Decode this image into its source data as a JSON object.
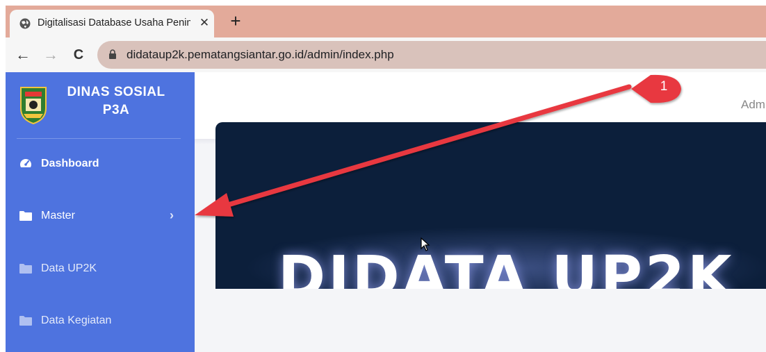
{
  "browser": {
    "tab": {
      "title": "Digitalisasi Database Usaha Penin",
      "close_glyph": "✕"
    },
    "new_tab_glyph": "+",
    "nav": {
      "back_glyph": "←",
      "forward_glyph": "→",
      "reload_glyph": "C"
    },
    "url": "didataup2k.pematangsiantar.go.id/admin/index.php"
  },
  "sidebar": {
    "brand_line1": "DINAS SOSIAL",
    "brand_line2": "P3A",
    "items": [
      {
        "label": "Dashboard",
        "icon": "tachometer-icon"
      },
      {
        "label": "Master",
        "icon": "folder-icon",
        "chevron": "›"
      },
      {
        "label": "Data UP2K",
        "icon": "folder-icon"
      },
      {
        "label": "Data Kegiatan",
        "icon": "folder-icon"
      }
    ]
  },
  "topbar": {
    "user_label": "Adm"
  },
  "banner": {
    "title": "DIDATA UP2K"
  },
  "annotation": {
    "marker_number": "1",
    "color": "#e8393f"
  },
  "colors": {
    "sidebar": "#4e73df",
    "tabstrip": "#e3aa9a",
    "banner": "#0c1f3b"
  }
}
